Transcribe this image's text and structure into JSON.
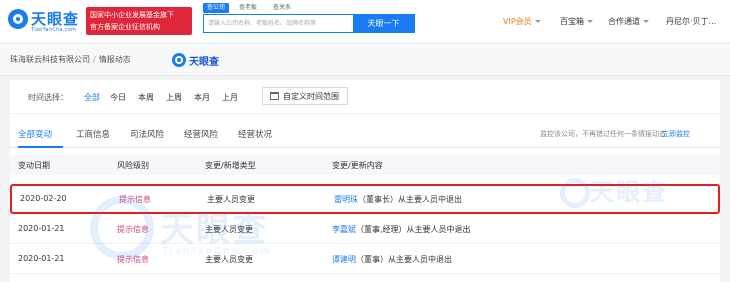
{
  "header": {
    "logo_text": "天眼查",
    "logo_sub": "TianYanCha.com",
    "gov_badge": [
      "国家中小企业发展基金旗下",
      "官方备案企业征信机构"
    ],
    "search_tabs": [
      "查公司",
      "查老板",
      "查关系"
    ],
    "search_placeholder": "请输入公司名称、老板姓名、品牌名称等",
    "search_button": "天眼一下",
    "nav": {
      "vip": "VIP会员",
      "baobao": "百宝箱",
      "coop": "合作通道",
      "user": "丹尼尔·贝丁..."
    }
  },
  "breadcrumb": {
    "company": "珠海联云科技有限公司",
    "separator": "/",
    "page": "情报动态",
    "brand": "天眼查"
  },
  "time_filter": {
    "label": "时间选择：",
    "options": [
      "全部",
      "今日",
      "本周",
      "上周",
      "本月",
      "上月"
    ],
    "active_index": 0,
    "custom_range": "自定义时间范围"
  },
  "tabs": {
    "items": [
      "全部变动",
      "工商信息",
      "司法风险",
      "经营风险",
      "经营状况"
    ],
    "active_index": 0,
    "follow_note": "监控该公司，不再错过任何一条情报动态",
    "follow_link": "立即监控"
  },
  "table": {
    "headers": [
      "变动日期",
      "风险级别",
      "变更/新增类型",
      "变更/更新内容"
    ],
    "rows": [
      {
        "date": "2020-02-20",
        "risk": "提示信息",
        "type": "主要人员变更",
        "person": "雷明珠",
        "rest": "（董事长）从主要人员中退出",
        "highlight": true
      },
      {
        "date": "2020-01-21",
        "risk": "提示信息",
        "type": "主要人员变更",
        "person": "李嘉斌",
        "rest": "（董事,经理）从主要人员中退出",
        "highlight": false
      },
      {
        "date": "2020-01-21",
        "risk": "提示信息",
        "type": "主要人员变更",
        "person": "谭建明",
        "rest": "（董事）从主要人员中退出",
        "highlight": false
      }
    ]
  },
  "watermark": {
    "text": "天眼查",
    "sub": "TianYanCha.com"
  },
  "colors": {
    "brand": "#1a7cf0",
    "gov_red": "#e0263a",
    "risk_pink": "#d6417a",
    "highlight_red": "#e02020",
    "vip_orange": "#e87b1f"
  }
}
